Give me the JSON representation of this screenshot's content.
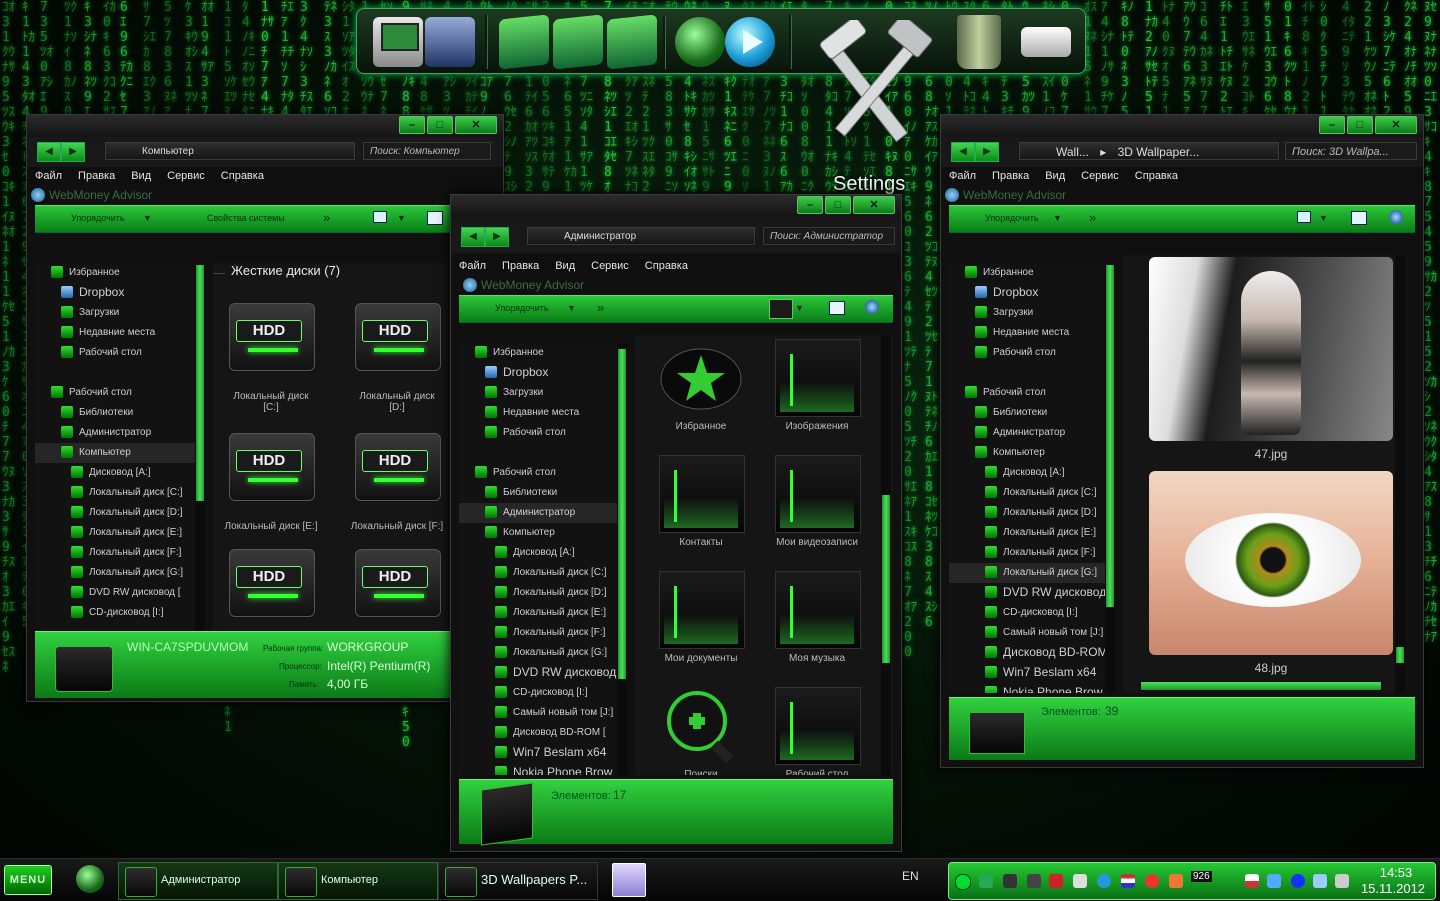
{
  "colors": {
    "accent": "#1fc22f",
    "accent_dark": "#0a7a16",
    "matrix": "#2fd84a",
    "window_bg": "#101010"
  },
  "background": {
    "matrix_glyphs": "ｱｲｳｴｵ01234567891ｶｷｸｹｺｻｼｽｾｿﾀﾁﾂﾃﾄﾅﾆﾇﾈﾉ"
  },
  "dock": {
    "icons": [
      "monitor-icon",
      "desktop-icon",
      "user-folder-icon",
      "pictures-folder-icon",
      "music-folder-icon",
      "globe-icon",
      "play-icon",
      "settings-tools-icon",
      "trash-icon",
      "display-icon"
    ],
    "settings_label": "Settings"
  },
  "window_computer": {
    "address": "Компьютер",
    "search": "Поиск: Компьютер",
    "menu": [
      "Файл",
      "Правка",
      "Вид",
      "Сервис",
      "Справка"
    ],
    "webmoney": "WebMoney Advisor",
    "cmd_organize": "Упорядочить",
    "cmd_sysprops": "Свойства системы",
    "cmd_more": "»",
    "nav": [
      {
        "label": "Избранное",
        "indent": 0,
        "big": false
      },
      {
        "label": "Dropbox",
        "indent": 1,
        "big": true
      },
      {
        "label": "Загрузки",
        "indent": 1,
        "big": false
      },
      {
        "label": "Недавние места",
        "indent": 1,
        "big": false
      },
      {
        "label": "Рабочий стол",
        "indent": 1,
        "big": false
      },
      {
        "label": "",
        "indent": 0,
        "big": false
      },
      {
        "label": "Рабочий стол",
        "indent": 0,
        "big": false
      },
      {
        "label": "Библиотеки",
        "indent": 1,
        "big": false
      },
      {
        "label": "Администратор",
        "indent": 1,
        "big": false
      },
      {
        "label": "Компьютер",
        "indent": 1,
        "big": false,
        "selected": true
      },
      {
        "label": "Дисковод [A:]",
        "indent": 2,
        "big": false
      },
      {
        "label": "Локальный диск [C:]",
        "indent": 2,
        "big": false
      },
      {
        "label": "Локальный диск [D:]",
        "indent": 2,
        "big": false
      },
      {
        "label": "Локальный диск [E:]",
        "indent": 2,
        "big": false
      },
      {
        "label": "Локальный диск [F:]",
        "indent": 2,
        "big": false
      },
      {
        "label": "Локальный диск [G:]",
        "indent": 2,
        "big": false
      },
      {
        "label": "DVD RW дисковод [",
        "indent": 2,
        "big": false
      },
      {
        "label": "CD-дисковод [I:]",
        "indent": 2,
        "big": false
      }
    ],
    "group_header": "Жесткие диски (7)",
    "drives": [
      {
        "label": "HDD",
        "caption": "Локальный диск\n[C:]"
      },
      {
        "label": "HDD",
        "caption": "Локальный диск\n[D:]"
      },
      {
        "label": "HDD",
        "caption": "Локальный диск [E:]"
      },
      {
        "label": "HDD",
        "caption": "Локальный диск [F:]"
      },
      {
        "label": "HDD",
        "caption": ""
      },
      {
        "label": "HDD",
        "caption": ""
      }
    ],
    "details": {
      "computer_name": "WIN-CA7SPDUVMOM",
      "workgroup_label": "Рабочая группа:",
      "workgroup": "WORKGROUP",
      "cpu_label": "Процессор:",
      "cpu": "Intel(R) Pentium(R)",
      "ram_label": "Память:",
      "ram": "4,00 ГБ"
    }
  },
  "window_admin": {
    "address": "Администратор",
    "search": "Поиск: Администратор",
    "menu": [
      "Файл",
      "Правка",
      "Вид",
      "Сервис",
      "Справка"
    ],
    "webmoney": "WebMoney Advisor",
    "cmd_organize": "Упорядочить",
    "cmd_more": "»",
    "nav": [
      {
        "label": "Избранное",
        "indent": 0,
        "big": false
      },
      {
        "label": "Dropbox",
        "indent": 1,
        "big": true
      },
      {
        "label": "Загрузки",
        "indent": 1,
        "big": false
      },
      {
        "label": "Недавние места",
        "indent": 1,
        "big": false
      },
      {
        "label": "Рабочий стол",
        "indent": 1,
        "big": false
      },
      {
        "label": "",
        "indent": 0,
        "big": false
      },
      {
        "label": "Рабочий стол",
        "indent": 0,
        "big": false
      },
      {
        "label": "Библиотеки",
        "indent": 1,
        "big": false
      },
      {
        "label": "Администратор",
        "indent": 1,
        "big": false,
        "selected": true
      },
      {
        "label": "Компьютер",
        "indent": 1,
        "big": false
      },
      {
        "label": "Дисковод [A:]",
        "indent": 2,
        "big": false
      },
      {
        "label": "Локальный диск [C:]",
        "indent": 2,
        "big": false
      },
      {
        "label": "Локальный диск [D:]",
        "indent": 2,
        "big": false
      },
      {
        "label": "Локальный диск [E:]",
        "indent": 2,
        "big": false
      },
      {
        "label": "Локальный диск [F:]",
        "indent": 2,
        "big": false
      },
      {
        "label": "Локальный диск [G:]",
        "indent": 2,
        "big": false
      },
      {
        "label": "DVD RW дисковод [",
        "indent": 2,
        "big": true
      },
      {
        "label": "CD-дисковод [I:]",
        "indent": 2,
        "big": false
      },
      {
        "label": "Самый новый том [J:]",
        "indent": 2,
        "big": false
      },
      {
        "label": "Дисковод BD-ROM [",
        "indent": 2,
        "big": false
      },
      {
        "label": "Win7 Beslam x64",
        "indent": 2,
        "big": true
      },
      {
        "label": "Nokia Phone Brow",
        "indent": 2,
        "big": true
      }
    ],
    "items": [
      {
        "caption": "Избранное",
        "icon": "star-icon"
      },
      {
        "caption": "Изображения",
        "icon": "folder-icon"
      },
      {
        "caption": "Контакты",
        "icon": "alien-folder-icon"
      },
      {
        "caption": "Мои видеозаписи",
        "icon": "folder-icon"
      },
      {
        "caption": "Мои документы",
        "icon": "documents-folder-icon"
      },
      {
        "caption": "Моя музыка",
        "icon": "folder-icon"
      },
      {
        "caption": "Поиски",
        "icon": "search-icon"
      },
      {
        "caption": "Рабочий стол",
        "icon": "desktop-folder-icon"
      }
    ],
    "details": {
      "count_label": "Элементов:",
      "count": "17"
    }
  },
  "window_wallpapers": {
    "address_1": "Wall...",
    "address_2": "3D Wallpaper...",
    "search": "Поиск: 3D Wallpa...",
    "menu": [
      "Файл",
      "Правка",
      "Вид",
      "Сервис",
      "Справка"
    ],
    "webmoney": "WebMoney Advisor",
    "cmd_organize": "Упорядочить",
    "cmd_more": "»",
    "nav": [
      {
        "label": "Избранное",
        "indent": 0,
        "big": false
      },
      {
        "label": "Dropbox",
        "indent": 1,
        "big": true
      },
      {
        "label": "Загрузки",
        "indent": 1,
        "big": false
      },
      {
        "label": "Недавние места",
        "indent": 1,
        "big": false
      },
      {
        "label": "Рабочий стол",
        "indent": 1,
        "big": false
      },
      {
        "label": "",
        "indent": 0,
        "big": false
      },
      {
        "label": "Рабочий стол",
        "indent": 0,
        "big": false
      },
      {
        "label": "Библиотеки",
        "indent": 1,
        "big": false
      },
      {
        "label": "Администратор",
        "indent": 1,
        "big": false
      },
      {
        "label": "Компьютер",
        "indent": 1,
        "big": false
      },
      {
        "label": "Дисковод [A:]",
        "indent": 2,
        "big": false
      },
      {
        "label": "Локальный диск [C:]",
        "indent": 2,
        "big": false
      },
      {
        "label": "Локальный диск [D:]",
        "indent": 2,
        "big": false
      },
      {
        "label": "Локальный диск [E:]",
        "indent": 2,
        "big": false
      },
      {
        "label": "Локальный диск [F:]",
        "indent": 2,
        "big": false
      },
      {
        "label": "Локальный диск [G:]",
        "indent": 2,
        "big": false,
        "selected": true
      },
      {
        "label": "DVD RW дисковод",
        "indent": 2,
        "big": true
      },
      {
        "label": "CD-дисковод [I:]",
        "indent": 2,
        "big": false
      },
      {
        "label": "Самый новый том [J:]",
        "indent": 2,
        "big": false
      },
      {
        "label": "Дисковод BD-ROM [",
        "indent": 2,
        "big": true
      },
      {
        "label": "Win7 Beslam x64",
        "indent": 2,
        "big": true
      },
      {
        "label": "Nokia Phone Brow",
        "indent": 2,
        "big": true
      }
    ],
    "images": [
      {
        "caption": "47.jpg",
        "subject": "android-woman-image"
      },
      {
        "caption": "48.jpg",
        "subject": "green-eye-image"
      }
    ],
    "details": {
      "count_label": "Элементов:",
      "count": "39"
    }
  },
  "taskbar": {
    "menu_label": "MENU",
    "tasks": [
      {
        "label": "Администратор"
      },
      {
        "label": "Компьютер"
      },
      {
        "label": "3D Wallpapers P..."
      }
    ],
    "language": "EN",
    "tray_badge": "926",
    "time": "14:53",
    "date": "15.11.2012"
  }
}
